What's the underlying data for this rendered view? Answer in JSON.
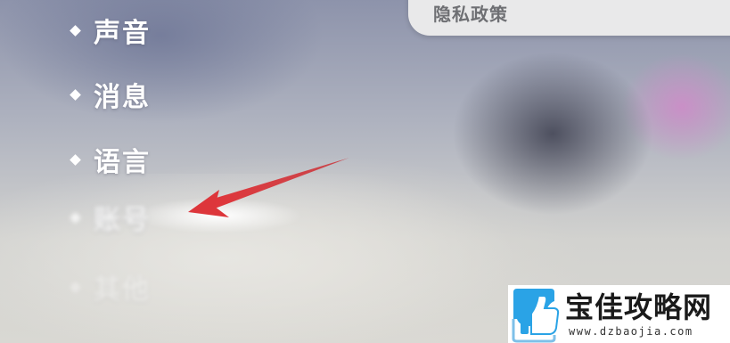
{
  "menu": {
    "items": [
      {
        "label": "声音",
        "icon": "diamond-bullet"
      },
      {
        "label": "消息",
        "icon": "diamond-bullet"
      },
      {
        "label": "语言",
        "icon": "diamond-bullet"
      },
      {
        "label": "账号",
        "icon": "diamond-bullet"
      },
      {
        "label": "其他",
        "icon": "diamond-bullet"
      }
    ]
  },
  "privacy": {
    "label": "隐私政策"
  },
  "annotation": {
    "icon": "red-arrow",
    "color": "#d9363b"
  },
  "watermark": {
    "title": "宝佳攻略网",
    "url": "www.dzbaojia.com",
    "logo_color": "#2aa3e6"
  }
}
